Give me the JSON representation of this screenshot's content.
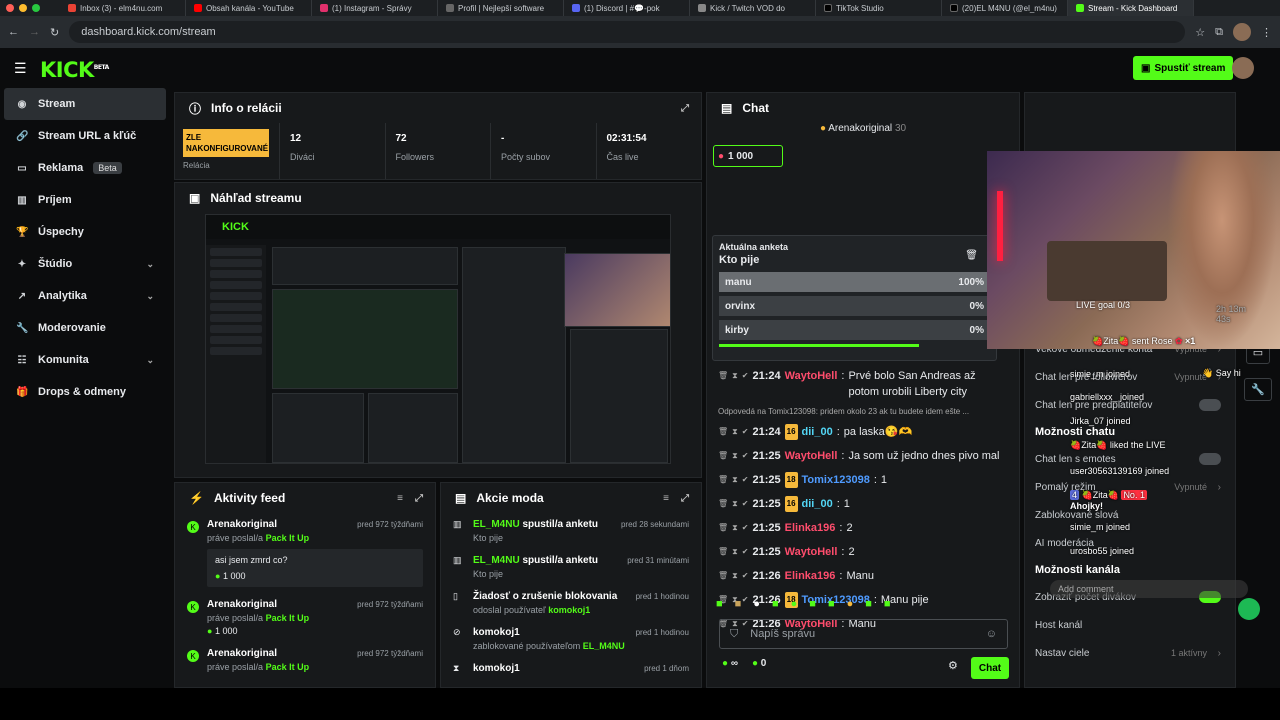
{
  "browser": {
    "tabs": [
      "Inbox (3) - elm4nu.com",
      "Obsah kanála - YouTube",
      "(1) Instagram - Správy",
      "Profil | Nejlepší software",
      "(1) Discord | #💬-pok",
      "Kick / Twitch VOD do",
      "TikTok Studio",
      "(20)EL M4NU (@el_m4nu)",
      "Stream - Kick Dashboard"
    ],
    "url": "dashboard.kick.com/stream"
  },
  "header": {
    "logo": "KICK",
    "logo_sup": "BETA",
    "start_stream": "Spustiť stream"
  },
  "sidebar": {
    "items": [
      {
        "label": "Stream",
        "icon": "broadcast-icon"
      },
      {
        "label": "Stream URL a kľúč",
        "icon": "link-icon"
      },
      {
        "label": "Reklama",
        "icon": "monitor-icon",
        "badge": "Beta"
      },
      {
        "label": "Príjem",
        "icon": "chart-icon"
      },
      {
        "label": "Úspechy",
        "icon": "trophy-icon"
      },
      {
        "label": "Štúdio",
        "icon": "studio-icon"
      },
      {
        "label": "Analytika",
        "icon": "analytics-icon"
      },
      {
        "label": "Moderovanie",
        "icon": "wrench-icon"
      },
      {
        "label": "Komunita",
        "icon": "community-icon"
      },
      {
        "label": "Drops & odmeny",
        "icon": "gift-icon"
      }
    ]
  },
  "session": {
    "title": "Info o relácii",
    "warning": "ZLE NAKONFIGUROVANÉ",
    "warning_sub": "Relácia",
    "stats": [
      {
        "value": "12",
        "label": "Diváci"
      },
      {
        "value": "72",
        "label": "Followers"
      },
      {
        "value": "-",
        "label": "Počty subov"
      },
      {
        "value": "02:31:54",
        "label": "Čas live"
      }
    ]
  },
  "preview": {
    "title": "Náhľad streamu"
  },
  "activity": {
    "title": "Aktivity feed",
    "items": [
      {
        "user": "Arenakoriginal",
        "text": "práve poslal/a",
        "item": "Pack It Up",
        "time": "pred 972 týždňami",
        "msg": "asi jsem zmrd co?",
        "amount": "1 000"
      },
      {
        "user": "Arenakoriginal",
        "text": "práve poslal/a",
        "item": "Pack It Up",
        "time": "pred 972 týždňami",
        "amount": "1 000"
      },
      {
        "user": "Arenakoriginal",
        "text": "práve poslal/a",
        "item": "Pack It Up",
        "time": "pred 972 týždňami"
      }
    ]
  },
  "modactions": {
    "title": "Akcie moda",
    "items": [
      {
        "title": "EL_M4NU spustil/a anketu",
        "user": "EL_M4NU",
        "rest": " spustil/a anketu",
        "sub": "Kto pije",
        "time": "pred 28 sekundami"
      },
      {
        "title": "EL_M4NU spustil/a anketu",
        "user": "EL_M4NU",
        "rest": " spustil/a anketu",
        "sub": "Kto pije",
        "time": "pred 31 minútami"
      },
      {
        "title": "Žiadosť o zrušenie blokovania",
        "sub": "odoslal používateľ",
        "sub_user": "komokoj1",
        "time": "pred 1 hodinou"
      },
      {
        "title": "komokoj1",
        "sub": "zablokované používateľom",
        "sub_user": "EL_M4NU",
        "time": "pred 1 hodinou"
      },
      {
        "title": "komokoj1",
        "time": "pred 1 dňom"
      }
    ]
  },
  "chat": {
    "title": "Chat",
    "pinned_user": "Arenakoriginal",
    "pinned_count": "30",
    "kicks": "1 000",
    "poll": {
      "label": "Aktuálna anketa",
      "question": "Kto pije",
      "options": [
        {
          "name": "manu",
          "pct": "100%",
          "fill": 1.0
        },
        {
          "name": "orvinx",
          "pct": "0%",
          "fill": 0
        },
        {
          "name": "kirby",
          "pct": "0%",
          "fill": 0
        }
      ]
    },
    "messages": [
      {
        "time": "21:24",
        "user": "WaytoHell",
        "color": "#ff4d6d",
        "text": "Prvé bolo San Andreas až potom urobili Liberty city"
      },
      {
        "reply": "Odpovedá na Tomix123098: pridem okolo 23 ak tu budete idem ešte ..."
      },
      {
        "time": "21:24",
        "badge": "16",
        "user": "dii_00",
        "color": "#53d6f5",
        "text": "pa laska😘🫶"
      },
      {
        "time": "21:25",
        "user": "WaytoHell",
        "color": "#ff4d6d",
        "text": "Ja som už jedno dnes pivo mal"
      },
      {
        "time": "21:25",
        "badge": "18",
        "user": "Tomix123098",
        "color": "#4f9bff",
        "text": "1"
      },
      {
        "time": "21:25",
        "badge": "16",
        "user": "dii_00",
        "color": "#53d6f5",
        "text": "1"
      },
      {
        "time": "21:25",
        "user": "Elinka196",
        "color": "#ff4d6d",
        "text": "2"
      },
      {
        "time": "21:25",
        "user": "WaytoHell",
        "color": "#ff4d6d",
        "text": "2"
      },
      {
        "time": "21:26",
        "user": "Elinka196",
        "color": "#ff4d6d",
        "text": "Manu"
      },
      {
        "time": "21:26",
        "badge": "18",
        "user": "Tomix123098",
        "color": "#4f9bff",
        "text": "Manu pije"
      },
      {
        "time": "21:26",
        "user": "WaytoHell",
        "color": "#ff4d6d",
        "text": "Manu"
      }
    ],
    "input_placeholder": "Napíš správu",
    "points": "0",
    "send": "Chat"
  },
  "settings": {
    "items": [
      {
        "label": "Chat prístup",
        "header": true
      },
      {
        "label": "Vekové obmedzenie konta",
        "value": "Vypnuté"
      },
      {
        "label": "Chat len pre followerov",
        "value": "Vypnuté"
      },
      {
        "label": "Chat len pre predplatiteľov",
        "toggle": false
      },
      {
        "label": "Možnosti chatu",
        "header": true
      },
      {
        "label": "Chat len s emotes",
        "toggle": false
      },
      {
        "label": "Pomalý režim",
        "value": "Vypnuté"
      },
      {
        "label": "Zablokované slová"
      },
      {
        "label": "AI moderácia"
      },
      {
        "label": "Možnosti kanála",
        "header": true
      },
      {
        "label": "Zobraziť počet divákov",
        "toggle": true
      },
      {
        "label": "Host kanál"
      },
      {
        "label": "Nastav ciele",
        "value": "1 aktívny"
      }
    ]
  },
  "overlay": {
    "live_goal": "LIVE goal 0/3",
    "duration": "2h 13m 43s",
    "gift_line": "sent Rose",
    "gift_x": "×1",
    "joins": [
      "simie_m joined",
      "gabriellxxx_ joined",
      "Jirka_07 joined",
      "liked the LIVE",
      "user30563139169 joined",
      "Ahojky!",
      "simie_m joined",
      "urosbo55 joined"
    ],
    "level": "4",
    "rank": "No. 1",
    "say_hi": "Say hi",
    "add_comment": "Add comment"
  }
}
